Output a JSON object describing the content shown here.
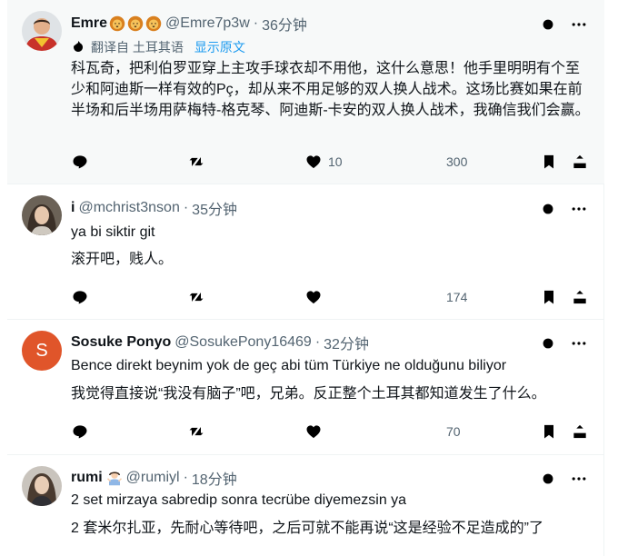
{
  "tweets": [
    {
      "display_name": "Emre",
      "emoji_icons": [
        "lion-face-icon",
        "lion-face-icon",
        "lion-face-icon"
      ],
      "handle": "@Emre7p3w",
      "time": "36分钟",
      "translate_label": "翻译自 土耳其语",
      "show_original": "显示原文",
      "text": "科瓦奇，把利伯罗亚穿上主攻手球衣却不用他，这什么意思！他手里明明有个至少和阿迪斯一样有效的Pç，却从来不用足够的双人换人战术。这场比赛如果在前半场和后半场用萨梅特-格克琴、阿迪斯-卡安的双人换人战术，我确信我们会赢。",
      "likes": "10",
      "views": "300"
    },
    {
      "display_name": "i",
      "handle": "@mchrist3nson",
      "time": "35分钟",
      "text": "ya bi siktir git",
      "translation": "滚开吧，贱人。",
      "likes": "",
      "views": "174"
    },
    {
      "display_name": "Sosuke Ponyo",
      "avatar_letter": "S",
      "handle": "@SosukePony16469",
      "time": "32分钟",
      "text": "Bence direkt beynim yok de geç abi tüm Türkiye ne olduğunu biliyor",
      "translation": "我觉得直接说“我没有脑子”吧，兄弟。反正整个土耳其都知道发生了什么。",
      "likes": "",
      "views": "70"
    },
    {
      "display_name": "rumi",
      "emoji_icons": [
        "person-gesturing-icon"
      ],
      "handle": "@rumiyl",
      "time": "18分钟",
      "text": "2 set mirzaya sabredip sonra tecrübe diyemezsin ya",
      "translation": "2 套米尔扎亚，先耐心等待吧，之后可就不能再说“这是经验不足造成的”了"
    }
  ],
  "colors": {
    "text": "#0f1419",
    "secondary": "#536471",
    "link": "#1d9bf0",
    "highlight_bg": "#f7f9f9",
    "divider": "#eff3f4",
    "avatar_s_bg": "#e0552a"
  }
}
